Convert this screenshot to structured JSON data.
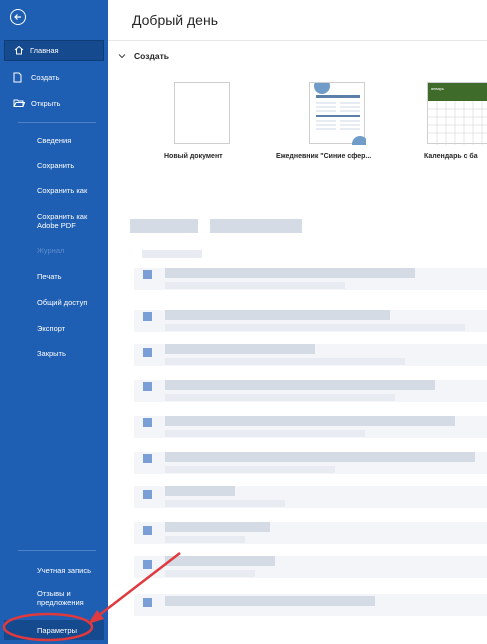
{
  "sidebar": {
    "home": "Главная",
    "create": "Создать",
    "open": "Открыть",
    "items": [
      "Сведения",
      "Сохранить",
      "Сохранить как",
      "Сохранить как Adobe PDF",
      "Журнал",
      "Печать",
      "Общий доступ",
      "Экспорт",
      "Закрыть"
    ],
    "account": "Учетная запись",
    "feedback": "Отзывы и предложения",
    "options": "Параметры"
  },
  "main": {
    "greeting": "Добрый день",
    "create_section": "Создать",
    "templates": [
      {
        "label": "Новый документ"
      },
      {
        "label": "Ежедневник \"Синие сфер..."
      },
      {
        "label": "Календарь с ба"
      }
    ],
    "calendar_month": "январь"
  },
  "colors": {
    "sidebar": "#1f5fb3",
    "sidebar_selected": "#154a8f",
    "annotation": "#e0393e"
  }
}
